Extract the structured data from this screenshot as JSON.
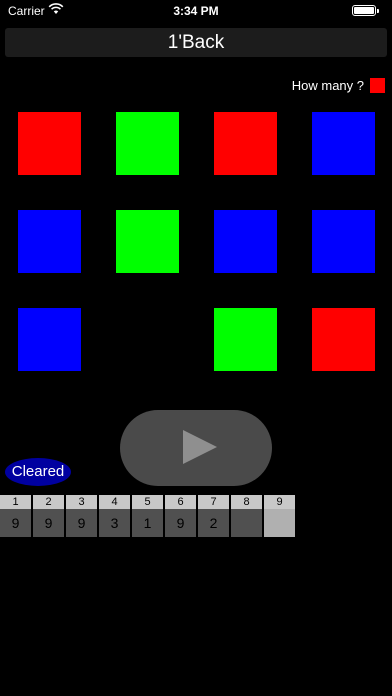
{
  "status_bar": {
    "carrier": "Carrier",
    "time": "3:34 PM"
  },
  "nav": {
    "title": "1'Back"
  },
  "prompt": {
    "label": "How many ?",
    "target_color": "#ff0000"
  },
  "colors": {
    "red": "#ff0000",
    "green": "#00ff00",
    "blue": "#0000ff"
  },
  "tiles": [
    "red",
    "green",
    "red",
    "blue",
    "blue",
    "green",
    "blue",
    "blue",
    "blue",
    "",
    "green",
    "red"
  ],
  "play_button": {
    "icon": "play-icon"
  },
  "status": {
    "cleared": "Cleared"
  },
  "score_table": {
    "headers": [
      "1",
      "2",
      "3",
      "4",
      "5",
      "6",
      "7",
      "8",
      "9"
    ],
    "values": [
      "9",
      "9",
      "9",
      "3",
      "1",
      "9",
      "2",
      "",
      ""
    ]
  }
}
